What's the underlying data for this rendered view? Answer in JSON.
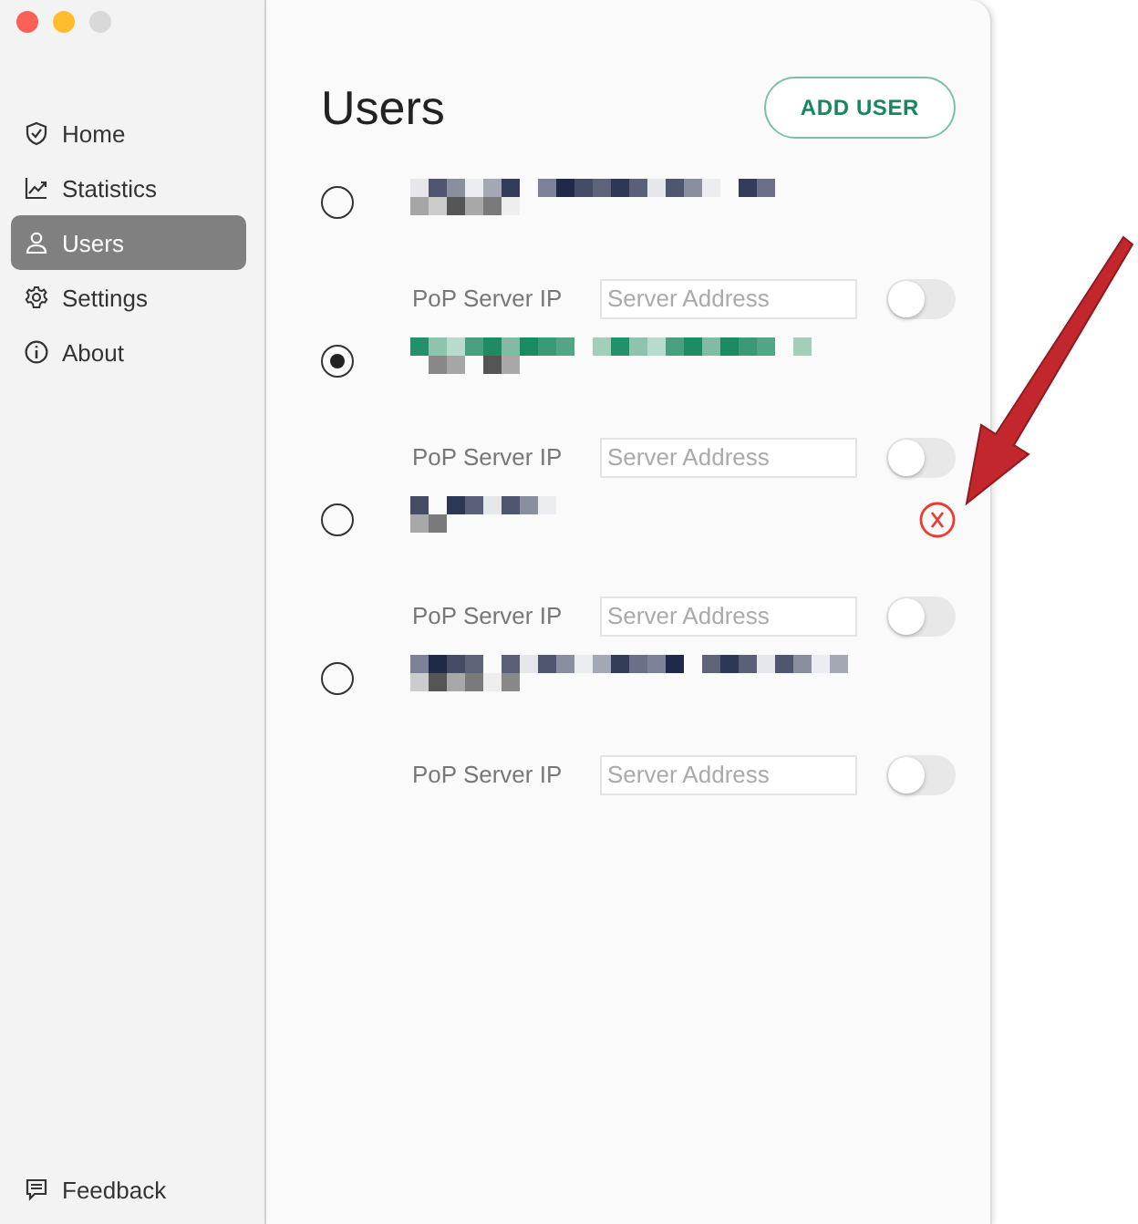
{
  "sidebar": {
    "items": [
      {
        "label": "Home",
        "selected": false
      },
      {
        "label": "Statistics",
        "selected": false
      },
      {
        "label": "Users",
        "selected": true
      },
      {
        "label": "Settings",
        "selected": false
      },
      {
        "label": "About",
        "selected": false
      }
    ],
    "footer": {
      "label": "Feedback"
    }
  },
  "main": {
    "title": "Users",
    "add_button": "ADD USER",
    "users": [
      {
        "selected": false,
        "removable": false,
        "server_label": "PoP Server IP",
        "placeholder": "Server Address",
        "on": false
      },
      {
        "selected": true,
        "removable": false,
        "server_label": "PoP Server IP",
        "placeholder": "Server Address",
        "on": false
      },
      {
        "selected": false,
        "removable": true,
        "server_label": "PoP Server IP",
        "placeholder": "Server Address",
        "on": false
      },
      {
        "selected": false,
        "removable": false,
        "server_label": "PoP Server IP",
        "placeholder": "Server Address",
        "on": false
      }
    ]
  }
}
